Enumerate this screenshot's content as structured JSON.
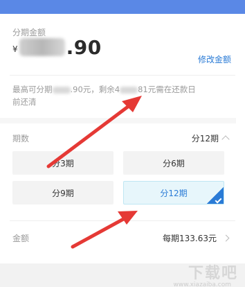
{
  "colors": {
    "top_band": "#5a88e6",
    "link": "#2a7bd6",
    "arrow": "#e53935",
    "pill_bg": "#f3f3f3",
    "pill_selected_bg": "#e7f6fb"
  },
  "amount_section": {
    "title": "分期金额",
    "currency_symbol": "¥",
    "amount_suffix": ".90",
    "modify_link": "修改金额"
  },
  "info": {
    "text_prefix": "最高可分期",
    "text_mid1": ".90元，剩余4",
    "text_mid2": "81元需在还款日",
    "text_suffix": "前还清"
  },
  "periods": {
    "label": "期数",
    "selected_label": "分12期",
    "options": [
      {
        "label": "分3期",
        "selected": false
      },
      {
        "label": "分6期",
        "selected": false
      },
      {
        "label": "分9期",
        "selected": false
      },
      {
        "label": "分12期",
        "selected": true
      }
    ]
  },
  "amount_row": {
    "label": "金额",
    "value": "每期133.63元"
  },
  "watermark": {
    "main": "下载吧",
    "sub": "www.xiazaiba.com"
  }
}
